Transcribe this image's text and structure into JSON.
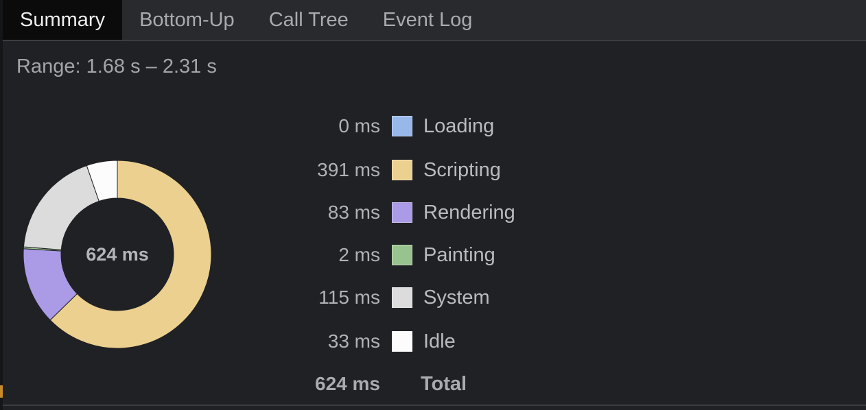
{
  "tabs": [
    {
      "label": "Summary",
      "active": true
    },
    {
      "label": "Bottom-Up",
      "active": false
    },
    {
      "label": "Call Tree",
      "active": false
    },
    {
      "label": "Event Log",
      "active": false
    }
  ],
  "range_label": "Range: 1.68 s – 2.31 s",
  "donut_center": "624 ms",
  "categories": [
    {
      "value_ms": 0,
      "value_label": "0 ms",
      "label": "Loading",
      "color": "#98b8ea"
    },
    {
      "value_ms": 391,
      "value_label": "391 ms",
      "label": "Scripting",
      "color": "#ecd08f"
    },
    {
      "value_ms": 83,
      "value_label": "83 ms",
      "label": "Rendering",
      "color": "#ab9ae6"
    },
    {
      "value_ms": 2,
      "value_label": "2 ms",
      "label": "Painting",
      "color": "#99c38e"
    },
    {
      "value_ms": 115,
      "value_label": "115 ms",
      "label": "System",
      "color": "#dcdcdc"
    },
    {
      "value_ms": 33,
      "value_label": "33 ms",
      "label": "Idle",
      "color": "#fcfcfc"
    }
  ],
  "total": {
    "value_label": "624 ms",
    "label": "Total"
  }
}
